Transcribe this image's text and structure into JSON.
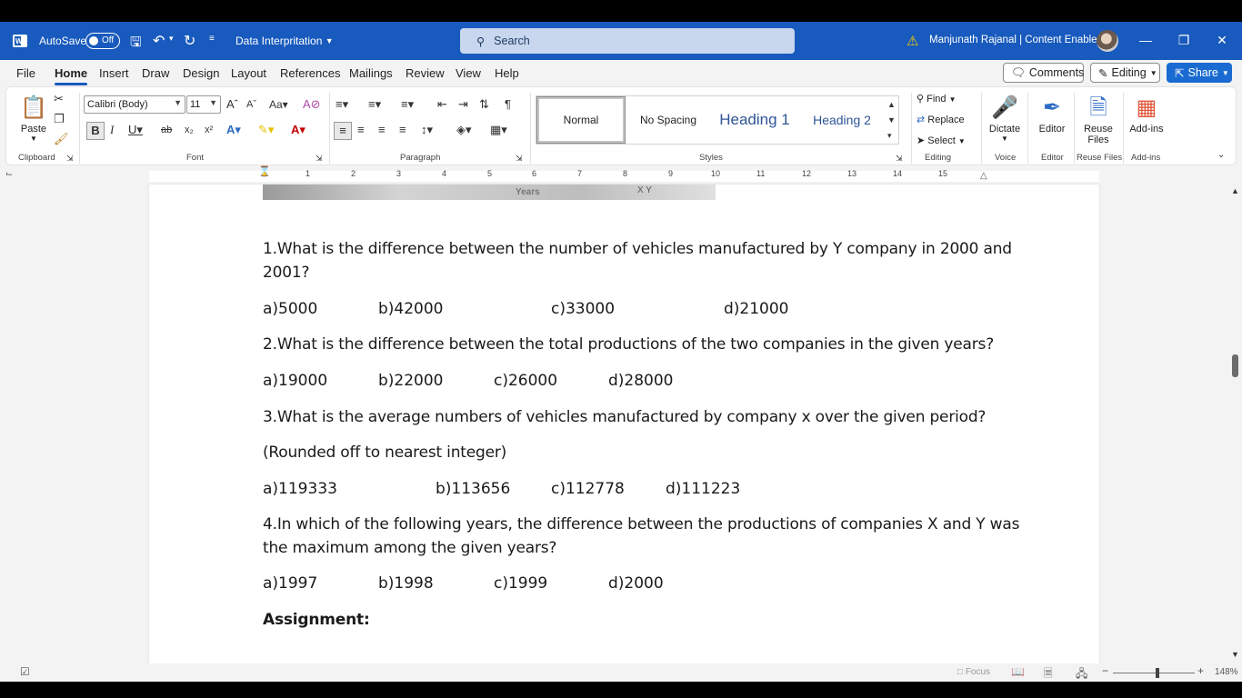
{
  "titlebar": {
    "autosave_label": "AutoSave",
    "autosave_state": "Off",
    "doc_title": "Data Interpritation",
    "search_placeholder": "Search",
    "user": "Manjunath Rajanal | Content Enablers",
    "accent": "#185abd"
  },
  "menu": {
    "tabs": [
      "File",
      "Home",
      "Insert",
      "Draw",
      "Design",
      "Layout",
      "References",
      "Mailings",
      "Review",
      "View",
      "Help"
    ],
    "active": "Home",
    "comments": "Comments",
    "editing": "Editing",
    "share": "Share"
  },
  "ribbon": {
    "clipboard": {
      "paste": "Paste",
      "label": "Clipboard"
    },
    "font": {
      "family": "Calibri (Body)",
      "size": "11",
      "label": "Font"
    },
    "paragraph": {
      "label": "Paragraph"
    },
    "styles": {
      "items": [
        "Normal",
        "No Spacing",
        "Heading 1",
        "Heading 2"
      ],
      "label": "Styles"
    },
    "editing": {
      "find": "Find",
      "replace": "Replace",
      "select": "Select",
      "label": "Editing"
    },
    "voice": {
      "dictate": "Dictate",
      "label": "Voice"
    },
    "editor": {
      "editor": "Editor",
      "label": "Editor"
    },
    "reuse": {
      "line1": "Reuse",
      "line2": "Files",
      "label": "Reuse Files"
    },
    "addins": {
      "addins": "Add-ins",
      "label": "Add-ins"
    }
  },
  "ruler": {
    "numbers": [
      "1",
      "2",
      "3",
      "4",
      "5",
      "6",
      "7",
      "8",
      "9",
      "10",
      "11",
      "12",
      "13",
      "14",
      "15"
    ]
  },
  "document": {
    "chart_fragment": {
      "axis_label": "Years",
      "legend": "X  Y"
    },
    "q1_line1": "1.What is the difference between the number of vehicles manufactured by Y company in 2000 and",
    "q1_line2": "2001?",
    "q1_opts": [
      "a)5000",
      "b)42000",
      "c)33000",
      "d)21000"
    ],
    "q2": "2.What is the difference between the total productions of the two companies in the given years?",
    "q2_opts": [
      "a)19000",
      "b)22000",
      "c)26000",
      "d)28000"
    ],
    "q3": "3.What is the average numbers of vehicles manufactured by company x over the given period?",
    "q3_note": "(Rounded off to nearest integer)",
    "q3_opts": [
      "a)119333",
      "b)113656",
      "c)112778",
      "d)111223"
    ],
    "q4_line1": "4.In which of the following years, the difference between the productions of companies X and Y was",
    "q4_line2": "the maximum among the given years?",
    "q4_opts": [
      "a)1997",
      "b)1998",
      "c)1999",
      "d)2000"
    ],
    "assignment": "Assignment:"
  },
  "status": {
    "focus": "Focus",
    "zoom": "148%"
  }
}
